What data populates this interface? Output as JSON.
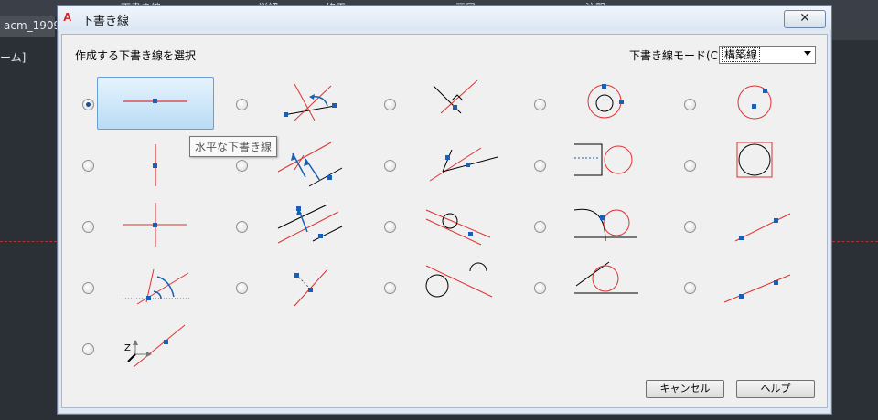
{
  "background": {
    "ribbon_labels": [
      "下書き線 ▾",
      "詳細 ▾",
      "修正 ▾",
      "画層 ▾",
      "注釈"
    ],
    "doc_tab": "acm_1909",
    "status_text": "ーム]"
  },
  "dialog": {
    "title": "下書き線",
    "close_label": "✕",
    "select_label": "作成する下書き線を選択",
    "mode_label": "下書き線モード(C):",
    "mode_value": "構築線",
    "tooltip": "水平な下書き線",
    "cancel_label": "キャンセル",
    "help_label": "ヘルプ"
  },
  "options": {
    "selected": "horizontal-line",
    "items": [
      "horizontal-line",
      "angle-line-by-point",
      "bisector-line",
      "circle-through-point",
      "circle-center-point",
      "vertical-line",
      "parallel-offset-line",
      "angle-from-line",
      "tangent-circle-to-line",
      "circle-in-square",
      "cross-lines",
      "parallel-at-distance",
      "tangent-line-to-circle",
      "circle-tangent-two-lines",
      "line-through-two-points",
      "angle-to-horizontal",
      "perpendicular-line",
      "tangent-to-two-circles",
      "circle-tangent-line-and-line",
      "line-two-points-alt",
      "line-along-z-axis"
    ]
  },
  "colors": {
    "red": "#e03030",
    "blue": "#1a5fb4",
    "selected_fill": "#b9dcf5"
  },
  "axis_labels": {
    "z": "Z"
  }
}
